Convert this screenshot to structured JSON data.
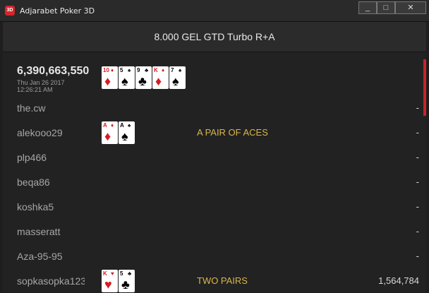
{
  "window": {
    "title": "Adjarabet Poker 3D",
    "icon_text": "3D"
  },
  "window_controls": {
    "minimize": "_",
    "maximize": "□",
    "close": "✕"
  },
  "header": {
    "title": "8.000 GEL GTD Turbo R+A"
  },
  "hand": {
    "number": "6,390,663,550",
    "date": "Thu Jan 26 2017",
    "time": "12:26:21 AM"
  },
  "board": [
    {
      "rank": "10",
      "suit": "♦",
      "color": "red"
    },
    {
      "rank": "5",
      "suit": "♠",
      "color": "black"
    },
    {
      "rank": "9",
      "suit": "♣",
      "color": "black"
    },
    {
      "rank": "K",
      "suit": "♦",
      "color": "red"
    },
    {
      "rank": "7",
      "suit": "♠",
      "color": "black"
    }
  ],
  "players": [
    {
      "name": "the.cw",
      "cards": [],
      "result": "",
      "amount": "-"
    },
    {
      "name": "alekooo29",
      "cards": [
        {
          "rank": "A",
          "suit": "♦",
          "color": "red"
        },
        {
          "rank": "A",
          "suit": "♠",
          "color": "black"
        }
      ],
      "result": "A PAIR OF ACES",
      "amount": "-"
    },
    {
      "name": "plp466",
      "cards": [],
      "result": "",
      "amount": "-"
    },
    {
      "name": "beqa86",
      "cards": [],
      "result": "",
      "amount": "-"
    },
    {
      "name": "koshka5",
      "cards": [],
      "result": "",
      "amount": "-"
    },
    {
      "name": "masseratt",
      "cards": [],
      "result": "",
      "amount": "-"
    },
    {
      "name": "Aza-95-95",
      "cards": [],
      "result": "",
      "amount": "-"
    },
    {
      "name": "sopkasopka123",
      "cards": [
        {
          "rank": "K",
          "suit": "♥",
          "color": "red"
        },
        {
          "rank": "5",
          "suit": "♣",
          "color": "black"
        }
      ],
      "result": "TWO PAIRS",
      "amount": "1,564,784"
    }
  ]
}
